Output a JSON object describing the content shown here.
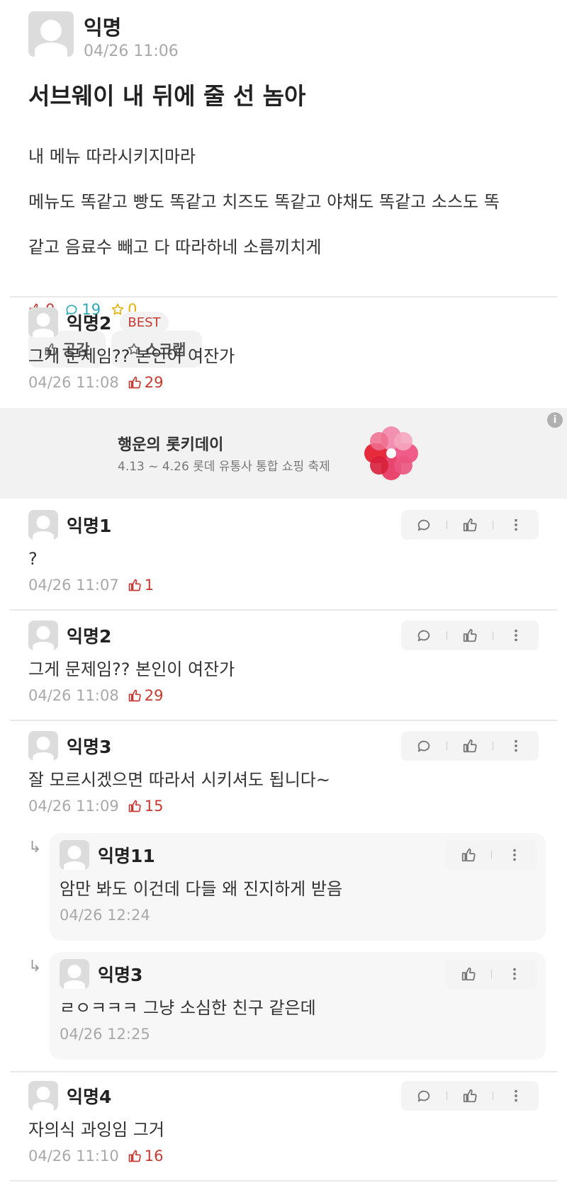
{
  "post": {
    "author": "익명",
    "time": "04/26 11:06",
    "title": "서브웨이 내 뒤에 줄 선 놈아",
    "body_lines": [
      "내 메뉴 따라시키지마라",
      "메뉴도 똑같고 빵도 똑같고 치즈도 똑같고 야채도 똑같고 소스도 똑",
      "같고 음료수 빼고 다 따라하네 소름끼치게"
    ],
    "likes": "0",
    "comments": "19",
    "scraps": "0",
    "like_button": "공감",
    "scrap_button": "스크랩"
  },
  "best_comment": {
    "author": "익명2",
    "badge": "BEST",
    "text": "그게 문제임?? 본인이 여잔가",
    "time": "04/26 11:08",
    "likes": "29"
  },
  "ad": {
    "title": "행운의 롯키데이",
    "subtitle": "4.13 ~ 4.26 롯데 유통사 통합 쇼핑 축제",
    "info": "i"
  },
  "comments": [
    {
      "author": "익명1",
      "text": "?",
      "time": "04/26 11:07",
      "likes": "1"
    },
    {
      "author": "익명2",
      "text": "그게 문제임?? 본인이 여잔가",
      "time": "04/26 11:08",
      "likes": "29"
    },
    {
      "author": "익명3",
      "text": "잘 모르시겠으면 따라서 시키셔도 됩니다~",
      "time": "04/26 11:09",
      "likes": "15"
    },
    {
      "author": "익명4",
      "text": "자의식 과잉임 그거",
      "time": "04/26 11:10",
      "likes": "16"
    }
  ],
  "replies": [
    {
      "author": "익명11",
      "text": "암만 봐도 이건데 다들 왜 진지하게 받음",
      "time": "04/26 12:24"
    },
    {
      "author": "익명3",
      "text": "ㄹㅇㅋㅋㅋ 그냥 소심한 친구 같은데",
      "time": "04/26 12:25"
    }
  ],
  "colors": {
    "like": "#c63a32",
    "comment": "#2fa7b5",
    "scrap": "#e1b410",
    "meta": "#a8a8a8"
  }
}
